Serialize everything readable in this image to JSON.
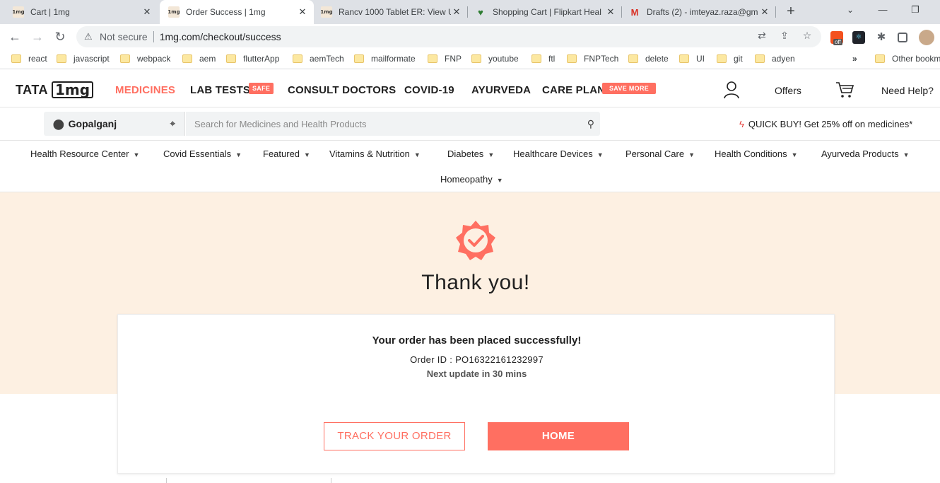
{
  "browser": {
    "tabs": [
      {
        "title": "Cart | 1mg",
        "favicon": "1mg"
      },
      {
        "title": "Order Success | 1mg",
        "favicon": "1mg"
      },
      {
        "title": "Rancv 1000 Tablet ER: View U",
        "favicon": "1mg"
      },
      {
        "title": "Shopping Cart | Flipkart Heal",
        "favicon": "flipkart-health-icon"
      },
      {
        "title": "Drafts (2) - imteyaz.raza@gm",
        "favicon": "gmail-icon"
      }
    ],
    "not_secure": "Not secure",
    "url": "1mg.com/checkout/success",
    "ext_badge": "off",
    "bookmarks": [
      "react",
      "javascript",
      "webpack",
      "aem",
      "flutterApp",
      "aemTech",
      "mailformate",
      "FNP",
      "youtube",
      "ftl",
      "FNPTech",
      "delete",
      "UI",
      "git",
      "adyen"
    ],
    "bookmarks_more": "»",
    "other_bookmarks": "Other bookm"
  },
  "header": {
    "logo_tata": "TATA",
    "logo_1mg": "1mg",
    "nav": [
      {
        "label": "MEDICINES"
      },
      {
        "label": "LAB TESTS",
        "tag": "SAFE"
      },
      {
        "label": "CONSULT DOCTORS"
      },
      {
        "label": "COVID-19"
      },
      {
        "label": "AYURVEDA"
      },
      {
        "label": "CARE PLAN",
        "tag": "SAVE MORE"
      }
    ],
    "offers": "Offers",
    "help": "Need Help?"
  },
  "search": {
    "location": "Gopalganj",
    "placeholder": "Search for Medicines and Health Products",
    "quick_buy": "QUICK BUY! Get 25% off on medicines*"
  },
  "categories": [
    "Health Resource Center",
    "Covid Essentials",
    "Featured",
    "Vitamins & Nutrition",
    "Diabetes",
    "Healthcare Devices",
    "Personal Care",
    "Health Conditions",
    "Ayurveda Products",
    "Homeopathy"
  ],
  "success": {
    "heading": "Thank you!",
    "message": "Your order has been placed successfully!",
    "order_id": "Order ID : PO16322161232997",
    "next_update": "Next update in 30 mins",
    "track_label": "TRACK YOUR ORDER",
    "home_label": "HOME"
  },
  "colors": {
    "accent": "#ff6f61",
    "hero_bg": "#fdf0e2"
  }
}
